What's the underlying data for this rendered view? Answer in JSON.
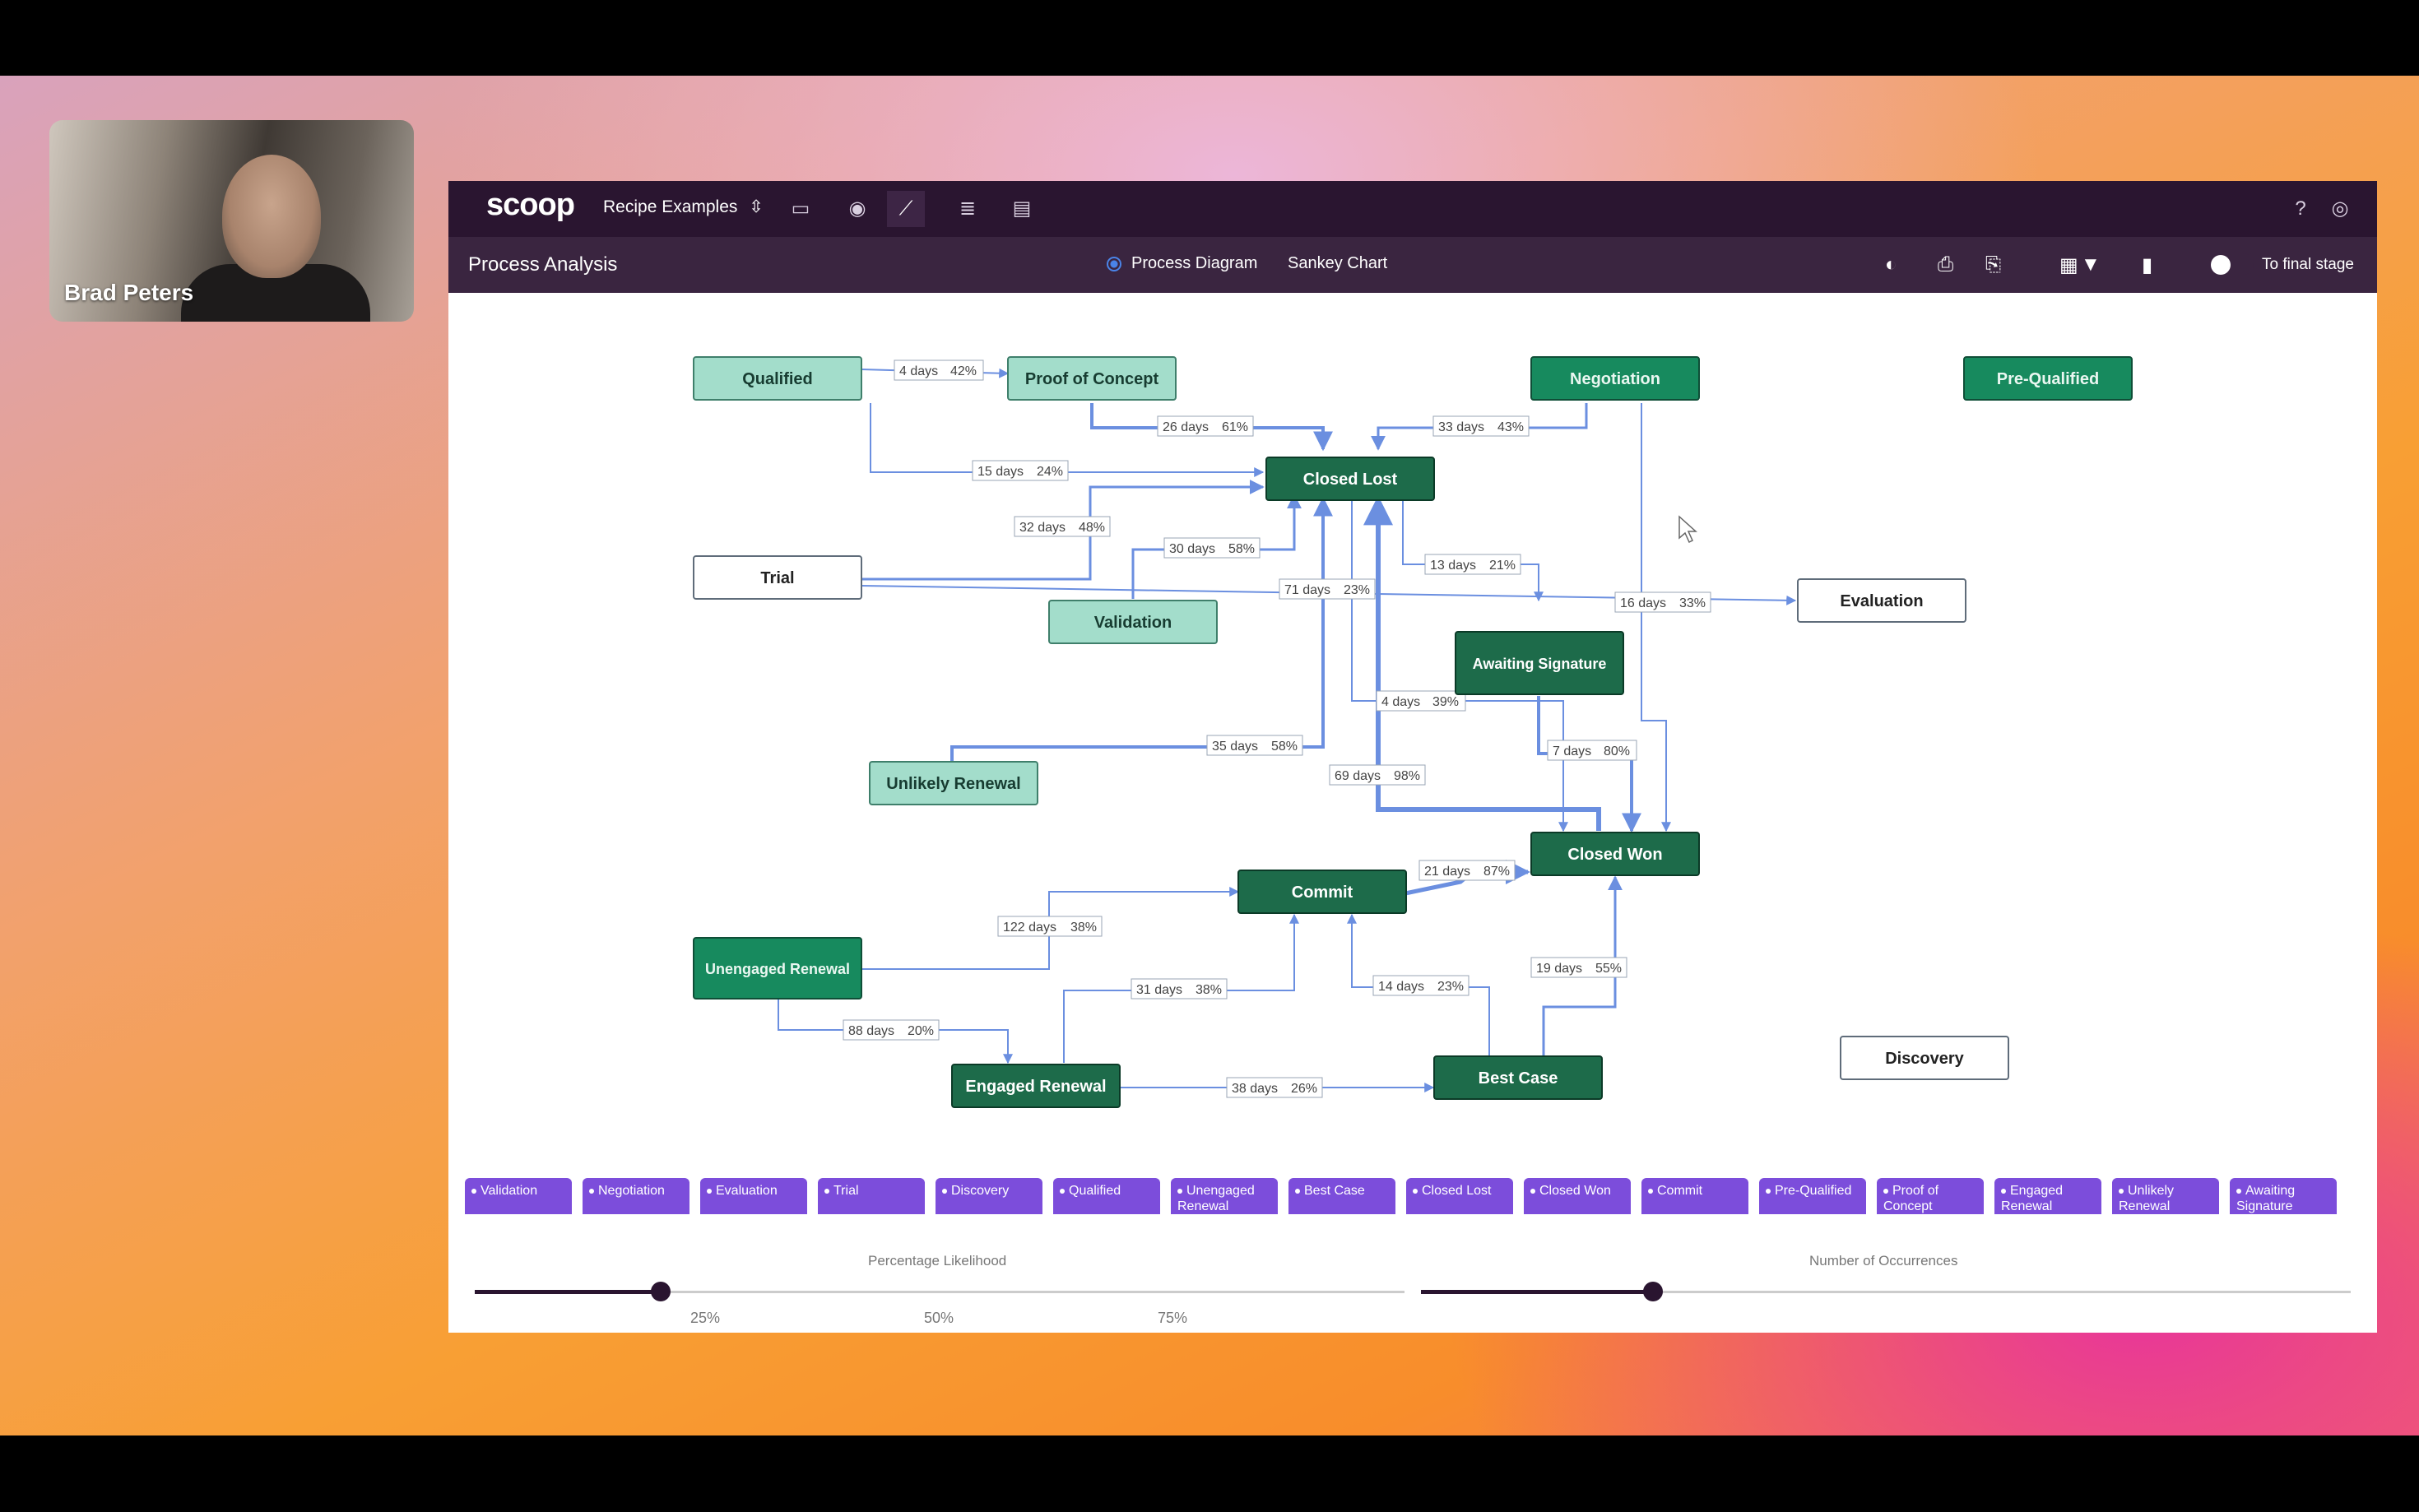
{
  "meeting": {
    "participant_name": "Brad Peters"
  },
  "topbar": {
    "logo": "scoop",
    "workspace": "Recipe Examples",
    "nav_icons": [
      "presentation-icon",
      "eye-icon",
      "chart-line-icon",
      "database-icon",
      "report-icon"
    ],
    "right_icons": [
      "help-icon",
      "account-icon"
    ]
  },
  "subbar": {
    "title": "Process Analysis",
    "view_options": [
      "Process Diagram",
      "Sankey Chart"
    ],
    "selected_view": "Process Diagram",
    "tools": [
      "palette-icon",
      "save-icon",
      "export-icon",
      "calendar-icon",
      "filter-icon",
      "document-icon"
    ],
    "final_toggle_label": "To final stage"
  },
  "diagram": {
    "nodes": [
      {
        "id": "qualified",
        "label": "Qualified",
        "style": "light"
      },
      {
        "id": "poc",
        "label": "Proof of Concept",
        "style": "light"
      },
      {
        "id": "negotiation",
        "label": "Negotiation",
        "style": "mid"
      },
      {
        "id": "prequalified",
        "label": "Pre-Qualified",
        "style": "mid"
      },
      {
        "id": "closedlost",
        "label": "Closed Lost",
        "style": "dark"
      },
      {
        "id": "trial",
        "label": "Trial",
        "style": "white"
      },
      {
        "id": "validation",
        "label": "Validation",
        "style": "light"
      },
      {
        "id": "evaluation",
        "label": "Evaluation",
        "style": "white"
      },
      {
        "id": "awaiting",
        "label": "Awaiting Signature",
        "style": "dark"
      },
      {
        "id": "unlikely",
        "label": "Unlikely Renewal",
        "style": "light"
      },
      {
        "id": "closedwon",
        "label": "Closed Won",
        "style": "dark"
      },
      {
        "id": "commit",
        "label": "Commit",
        "style": "dark"
      },
      {
        "id": "unengaged",
        "label": "Unengaged Renewal",
        "style": "mid"
      },
      {
        "id": "engaged",
        "label": "Engaged Renewal",
        "style": "dark"
      },
      {
        "id": "bestcase",
        "label": "Best Case",
        "style": "dark"
      },
      {
        "id": "discovery",
        "label": "Discovery",
        "style": "white"
      }
    ],
    "edge_labels": [
      {
        "days": "4 days",
        "pct": "42%"
      },
      {
        "days": "26 days",
        "pct": "61%"
      },
      {
        "days": "33 days",
        "pct": "43%"
      },
      {
        "days": "15 days",
        "pct": "24%"
      },
      {
        "days": "32 days",
        "pct": "48%"
      },
      {
        "days": "30 days",
        "pct": "58%"
      },
      {
        "days": "13 days",
        "pct": "21%"
      },
      {
        "days": "71 days",
        "pct": "23%"
      },
      {
        "days": "16 days",
        "pct": "33%"
      },
      {
        "days": "4 days",
        "pct": "39%"
      },
      {
        "days": "7 days",
        "pct": "80%"
      },
      {
        "days": "35 days",
        "pct": "58%"
      },
      {
        "days": "69 days",
        "pct": "98%"
      },
      {
        "days": "21 days",
        "pct": "87%"
      },
      {
        "days": "122 days",
        "pct": "38%"
      },
      {
        "days": "31 days",
        "pct": "38%"
      },
      {
        "days": "14 days",
        "pct": "23%"
      },
      {
        "days": "19 days",
        "pct": "55%"
      },
      {
        "days": "88 days",
        "pct": "20%"
      },
      {
        "days": "38 days",
        "pct": "26%"
      }
    ]
  },
  "stages": [
    "Validation",
    "Negotiation",
    "Evaluation",
    "Trial",
    "Discovery",
    "Qualified",
    "Unengaged Renewal",
    "Best Case",
    "Closed Lost",
    "Closed Won",
    "Commit",
    "Pre-Qualified",
    "Proof of Concept",
    "Engaged Renewal",
    "Unlikely Renewal",
    "Awaiting Signature"
  ],
  "sliders": {
    "likelihood": {
      "title": "Percentage Likelihood",
      "value_percent": 20,
      "ticks": [
        "25%",
        "50%",
        "75%"
      ]
    },
    "occurrences": {
      "title": "Number of Occurrences",
      "value_fraction": 0.25
    }
  },
  "colors": {
    "dark_node": "#1d6b4a",
    "mid_node": "#178a5e",
    "light_node": "#a3ddcb",
    "edge": "#6b8fe0",
    "stage_pill": "#7c4ddb",
    "topbar": "#2a1530"
  }
}
